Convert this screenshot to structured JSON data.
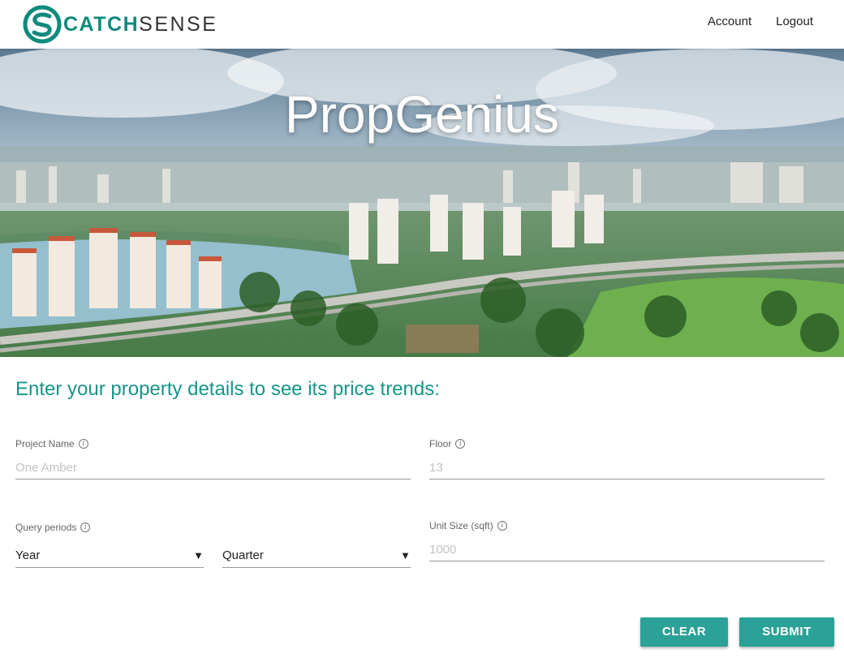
{
  "brand": {
    "name_bold": "CATCH",
    "name_light": "SENSE",
    "accent": "#16958a"
  },
  "nav": {
    "account": "Account",
    "logout": "Logout"
  },
  "hero": {
    "title": "PropGenius"
  },
  "form": {
    "heading": "Enter your property details to see its price trends:",
    "project_name": {
      "label": "Project Name",
      "placeholder": "One Amber"
    },
    "floor": {
      "label": "Floor",
      "placeholder": "13"
    },
    "query_periods": {
      "label": "Query periods",
      "year": "Year",
      "quarter": "Quarter"
    },
    "unit_size": {
      "label": "Unit Size (sqft)",
      "placeholder": "1000"
    },
    "clear": "CLEAR",
    "submit": "SUBMIT"
  },
  "icons": {
    "info": "info-icon",
    "dropdown": "triangle-down-icon"
  }
}
